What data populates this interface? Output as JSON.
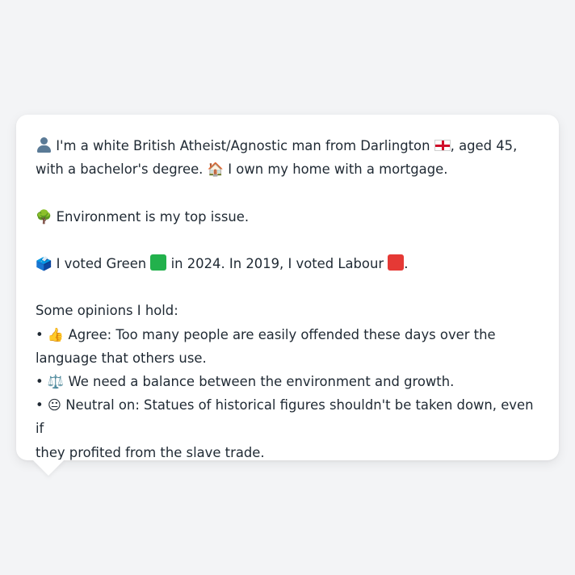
{
  "message": {
    "line1": {
      "icon": "person-icon",
      "text_a": " I'm a white British Atheist/Agnostic man from Darlington ",
      "flag_icon": "england-flag-icon",
      "text_b": ", aged 45,"
    },
    "line2": {
      "text_a": "with a bachelor's degree. ",
      "house_emoji": "🏠",
      "text_b": " I own my home with a mortgage."
    },
    "line3": {
      "tree_emoji": "🌳",
      "text": " Environment is my top issue."
    },
    "line4": {
      "ballot_emoji": "🗳️",
      "text_a": " I voted Green ",
      "green_square_color": "#22b14c",
      "text_b": " in 2024. In 2019, I voted Labour ",
      "red_square_color": "#e53935",
      "text_c": "."
    },
    "opinions": {
      "heading": "Some opinions I hold:",
      "bullet": "•",
      "items": [
        {
          "emoji": "👍",
          "text_line1": " Agree: Too many people are easily offended these days over the",
          "text_line2": "language that others use."
        },
        {
          "emoji": "⚖️",
          "text_line1": " We need a balance between the environment and growth."
        },
        {
          "emoji": "😐",
          "text_line1": " Neutral on: Statues of historical figures shouldn't be taken down, even if",
          "text_line2": "they profited from the slave trade."
        }
      ]
    }
  }
}
